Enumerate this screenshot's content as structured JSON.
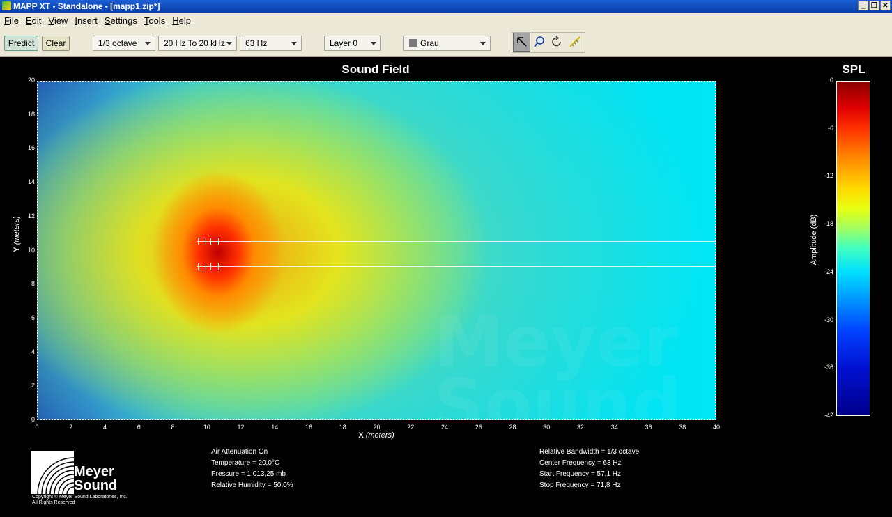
{
  "window": {
    "title": "MAPP XT - Standalone - [mapp1.zip*]",
    "controls": [
      "_",
      "❐",
      "✕"
    ]
  },
  "menu": [
    "File",
    "Edit",
    "View",
    "Insert",
    "Settings",
    "Tools",
    "Help"
  ],
  "toolbar": {
    "predict_label": "Predict",
    "clear_label": "Clear",
    "bandwidth": "1/3 octave",
    "freq_range": "20 Hz To 20 kHz",
    "frequency": "63 Hz",
    "layer": "Layer 0",
    "color_scheme": "Grau",
    "tools": [
      "pointer-icon",
      "zoom-icon",
      "rotate-icon",
      "measure-icon"
    ]
  },
  "plot": {
    "title": "Sound Field",
    "x_label": "X",
    "x_unit": "(meters)",
    "y_label": "Y",
    "y_unit": "(meters)",
    "x_ticks": [
      "0",
      "2",
      "4",
      "6",
      "8",
      "10",
      "12",
      "14",
      "16",
      "18",
      "20",
      "22",
      "24",
      "26",
      "28",
      "30",
      "32",
      "34",
      "36",
      "38",
      "40"
    ],
    "y_ticks": [
      "20",
      "18",
      "16",
      "14",
      "12",
      "10",
      "8",
      "6",
      "4",
      "2",
      "0"
    ],
    "watermark": [
      "Meyer",
      "Sound"
    ]
  },
  "colorbar": {
    "title": "SPL",
    "label": "Amplitude (dB)",
    "ticks": [
      "0",
      "-6",
      "-12",
      "-18",
      "-24",
      "-30",
      "-36",
      "-42"
    ]
  },
  "environment": {
    "air_attenuation": "Air Attenuation On",
    "temperature": "Temperature = 20,0°C",
    "pressure": "Pressure = 1.013,25  mb",
    "humidity": "Relative Humidity = 50,0%"
  },
  "analysis": {
    "bandwidth": "Relative Bandwidth = 1/3 octave",
    "center": "Center Frequency = 63 Hz",
    "start": "Start Frequency = 57,1 Hz",
    "stop": "Stop Frequency = 71,8 Hz"
  },
  "logo": {
    "line1": "Meyer",
    "line2": "Sound",
    "copyright": "Copyright © Meyer Sound Laboratories, Inc.",
    "rights": "All Rights Reserved"
  }
}
